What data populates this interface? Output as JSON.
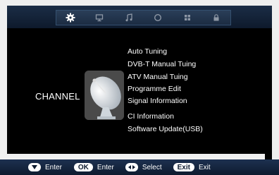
{
  "tabs": [
    {
      "icon": "gear-icon",
      "active": true
    },
    {
      "icon": "monitor-icon",
      "active": false
    },
    {
      "icon": "music-note-icon",
      "active": false
    },
    {
      "icon": "clock-icon",
      "active": false
    },
    {
      "icon": "grid-icon",
      "active": false
    },
    {
      "icon": "lock-icon",
      "active": false
    }
  ],
  "section_label": "CHANNEL",
  "menu": {
    "items": [
      "Auto Tuning",
      "DVB-T Manual Tuing",
      "ATV Manual Tuing",
      "Programme Edit",
      "Signal Information",
      "CI Information",
      "Software Update(USB)"
    ]
  },
  "footer": {
    "hints": [
      {
        "key_icon": "down-arrow-icon",
        "label": "Enter"
      },
      {
        "key_text": "OK",
        "label": "Enter"
      },
      {
        "key_icon": "left-right-arrows-icon",
        "label": "Select"
      },
      {
        "key_text": "Exit",
        "label": "Exit"
      }
    ]
  },
  "colors": {
    "top_bar": "#1b2d46",
    "bottom_bar": "#0e1b2f",
    "screen_bg": "#000000",
    "text": "#ffffff"
  }
}
